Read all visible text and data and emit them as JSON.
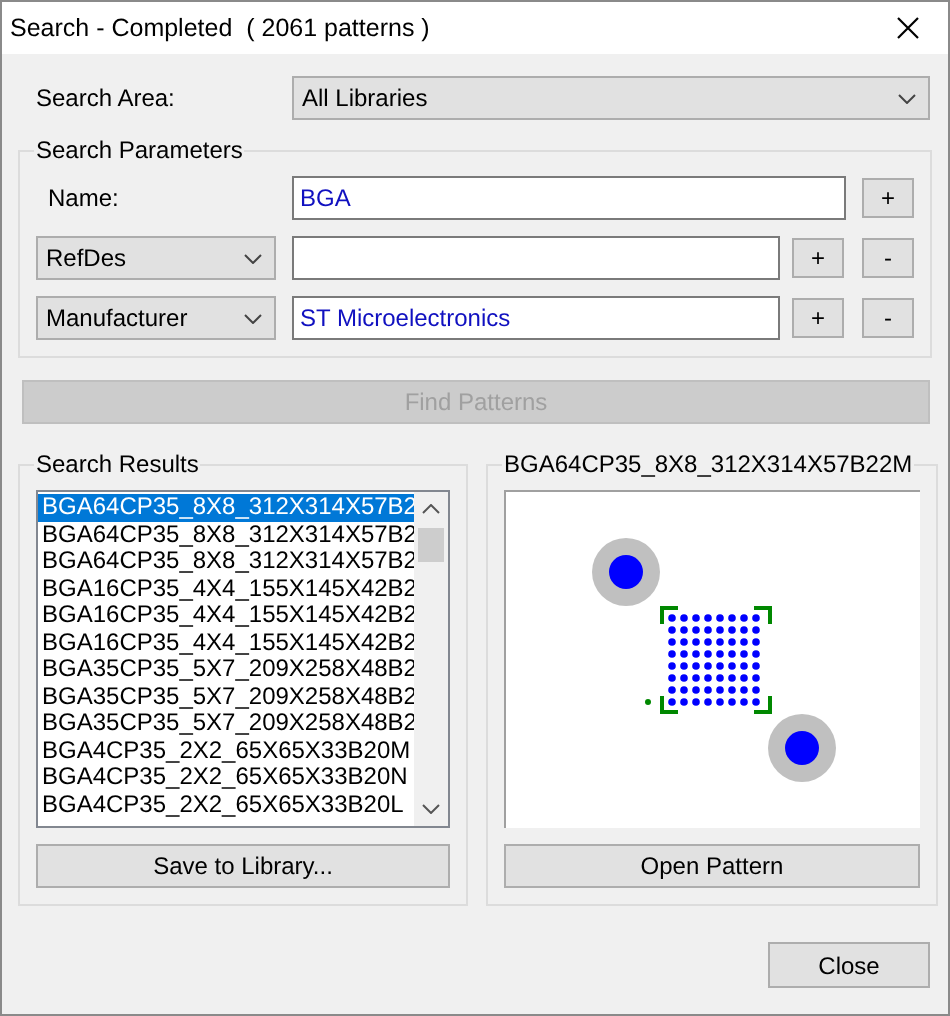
{
  "window": {
    "title": "Search - Completed  ( 2061 patterns )"
  },
  "search_area": {
    "label": "Search Area:",
    "value": "All Libraries"
  },
  "search_parameters": {
    "title": "Search Parameters",
    "rows": [
      {
        "kind": "label",
        "field": "Name:",
        "value": "BGA",
        "buttons": [
          "+"
        ]
      },
      {
        "kind": "dropdown",
        "field": "RefDes",
        "buttons": [
          "+",
          "-"
        ]
      },
      {
        "kind": "dropdown",
        "field": "Manufacturer",
        "value": "ST Microelectronics",
        "buttons": [
          "+",
          "-"
        ]
      }
    ]
  },
  "find_button": {
    "label": "Find Patterns",
    "disabled": true
  },
  "results": {
    "title": "Search Results",
    "button": "Save to Library...",
    "items": [
      {
        "text": "BGA64CP35_8X8_312X314X57B2",
        "selected": true
      },
      {
        "text": "BGA64CP35_8X8_312X314X57B2",
        "selected": false
      },
      {
        "text": "BGA64CP35_8X8_312X314X57B2",
        "selected": false
      },
      {
        "text": "BGA16CP35_4X4_155X145X42B2",
        "selected": false
      },
      {
        "text": "BGA16CP35_4X4_155X145X42B2",
        "selected": false
      },
      {
        "text": "BGA16CP35_4X4_155X145X42B2",
        "selected": false
      },
      {
        "text": "BGA35CP35_5X7_209X258X48B2",
        "selected": false
      },
      {
        "text": "BGA35CP35_5X7_209X258X48B2",
        "selected": false
      },
      {
        "text": "BGA35CP35_5X7_209X258X48B2",
        "selected": false
      },
      {
        "text": "BGA4CP35_2X2_65X65X33B20M",
        "selected": false
      },
      {
        "text": "BGA4CP35_2X2_65X65X33B20N",
        "selected": false
      },
      {
        "text": "BGA4CP35_2X2_65X65X33B20L",
        "selected": false
      }
    ]
  },
  "preview": {
    "title": "BGA64CP35_8X8_312X314X57B22M",
    "button": "Open Pattern"
  },
  "buttons": [
    "Close"
  ]
}
